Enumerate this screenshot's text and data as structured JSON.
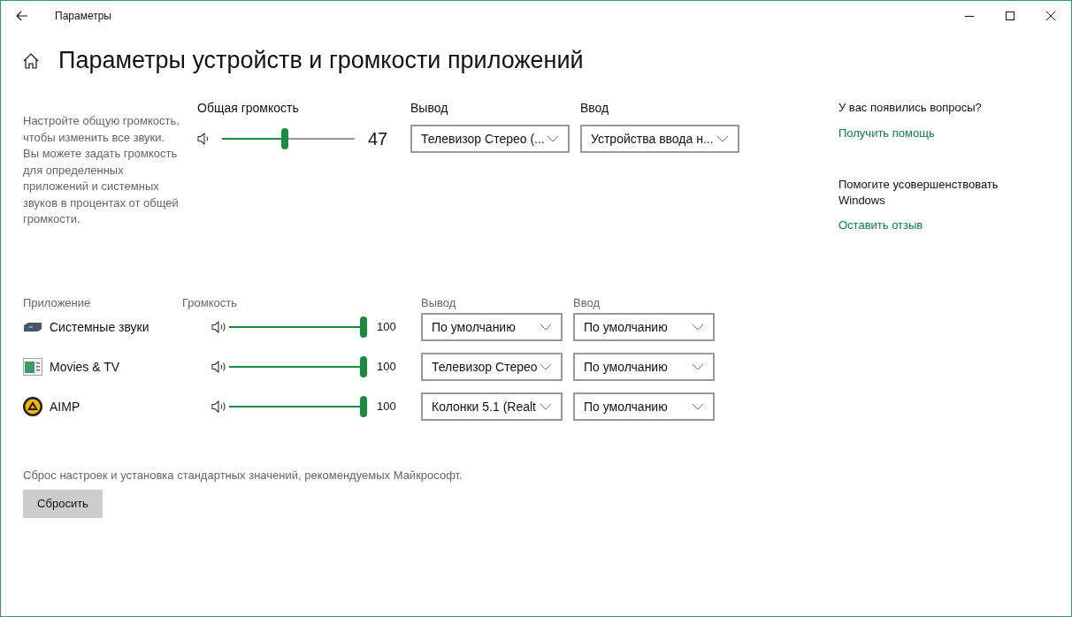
{
  "window": {
    "title": "Параметры"
  },
  "page": {
    "title": "Параметры устройств и громкости приложений"
  },
  "description": "Настройте общую громкость, чтобы изменить все звуки. Вы можете задать громкость для определенных приложений и системных звуков в процентах от общей громкости.",
  "master": {
    "label": "Общая громкость",
    "level": 0.47,
    "reading": "47"
  },
  "output": {
    "label": "Вывод",
    "value": "Телевизор Стерео (..."
  },
  "input": {
    "label": "Ввод",
    "value": "Устройства ввода н..."
  },
  "help": {
    "question": "У вас появились вопросы?",
    "link": "Получить помощь",
    "improve": "Помогите усовершенствовать Windows",
    "feedback": "Оставить отзыв"
  },
  "apps": {
    "columns": [
      "Приложение",
      "Громкость",
      "Вывод",
      "Ввод"
    ],
    "rows": [
      {
        "kind": "system",
        "name": "Системные звуки",
        "level": 1,
        "reading": "100",
        "output": "По умолчанию",
        "input": "По умолчанию"
      },
      {
        "kind": "movies",
        "name": "Movies & TV",
        "level": 1,
        "reading": "100",
        "output": "Телевизор Стерео",
        "input": "По умолчанию"
      },
      {
        "kind": "aimp",
        "name": "AIMP",
        "level": 1,
        "reading": "100",
        "output": "Колонки 5.1 (Realt",
        "input": "По умолчанию"
      }
    ]
  },
  "reset": {
    "text": "Сброс настроек и установка стандартных значений, рекомендуемых Майкрософт.",
    "button": "Сбросить"
  }
}
